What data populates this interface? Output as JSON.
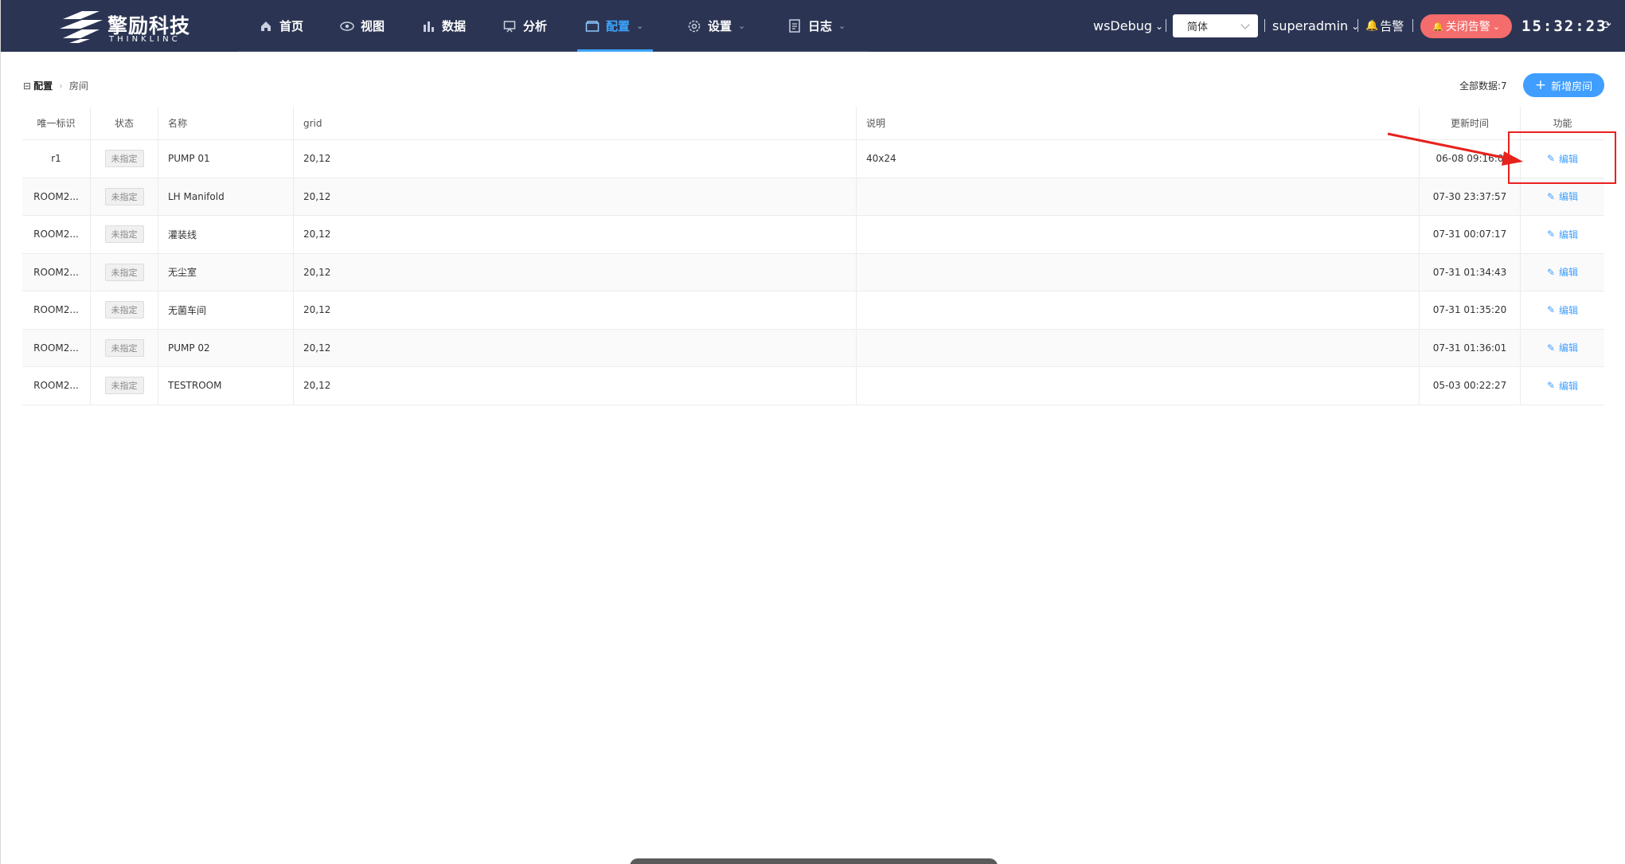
{
  "brand": {
    "name_cn": "擎励科技",
    "name_en": "THINKLINC"
  },
  "nav": [
    {
      "label": "首页",
      "icon": "home-icon",
      "dropdown": false,
      "active": false
    },
    {
      "label": "视图",
      "icon": "eye-icon",
      "dropdown": false,
      "active": false
    },
    {
      "label": "数据",
      "icon": "bar-chart-icon",
      "dropdown": false,
      "active": false
    },
    {
      "label": "分析",
      "icon": "presentation-icon",
      "dropdown": false,
      "active": false
    },
    {
      "label": "配置",
      "icon": "folder-icon",
      "dropdown": true,
      "active": true
    },
    {
      "label": "设置",
      "icon": "gear-icon",
      "dropdown": true,
      "active": false
    },
    {
      "label": "日志",
      "icon": "document-icon",
      "dropdown": true,
      "active": false
    }
  ],
  "toolbar": {
    "workspace": "wsDebug",
    "language": "简体",
    "user": "superadmin",
    "alarm_label": "告警",
    "close_alarm_label": "关闭告警",
    "clock": "15:32:23"
  },
  "breadcrumb": {
    "first": "配置",
    "last": "房间"
  },
  "summary": {
    "total_label": "全部数据:7",
    "add_label": "新增房间"
  },
  "table": {
    "columns": [
      "唯一标识",
      "状态",
      "名称",
      "grid",
      "说明",
      "更新时间",
      "功能"
    ],
    "edit_label": "编辑",
    "rows": [
      {
        "id": "r1",
        "status": "未指定",
        "name": "PUMP 01",
        "grid": "20,12",
        "desc": "40x24",
        "time": "06-08 09:16:0"
      },
      {
        "id": "ROOM2...",
        "status": "未指定",
        "name": "LH Manifold",
        "grid": "20,12",
        "desc": "",
        "time": "07-30 23:37:57"
      },
      {
        "id": "ROOM2...",
        "status": "未指定",
        "name": "灌装线",
        "grid": "20,12",
        "desc": "",
        "time": "07-31 00:07:17"
      },
      {
        "id": "ROOM2...",
        "status": "未指定",
        "name": "无尘室",
        "grid": "20,12",
        "desc": "",
        "time": "07-31 01:34:43"
      },
      {
        "id": "ROOM2...",
        "status": "未指定",
        "name": "无菌车间",
        "grid": "20,12",
        "desc": "",
        "time": "07-31 01:35:20"
      },
      {
        "id": "ROOM2...",
        "status": "未指定",
        "name": "PUMP 02",
        "grid": "20,12",
        "desc": "",
        "time": "07-31 01:36:01"
      },
      {
        "id": "ROOM2...",
        "status": "未指定",
        "name": "TESTROOM",
        "grid": "20,12",
        "desc": "",
        "time": "05-03 00:22:27"
      }
    ]
  },
  "colors": {
    "topbar": "#2b3553",
    "accent": "#3ea5ff",
    "alarm": "#f56c6c",
    "annotation": "#e8211d"
  }
}
